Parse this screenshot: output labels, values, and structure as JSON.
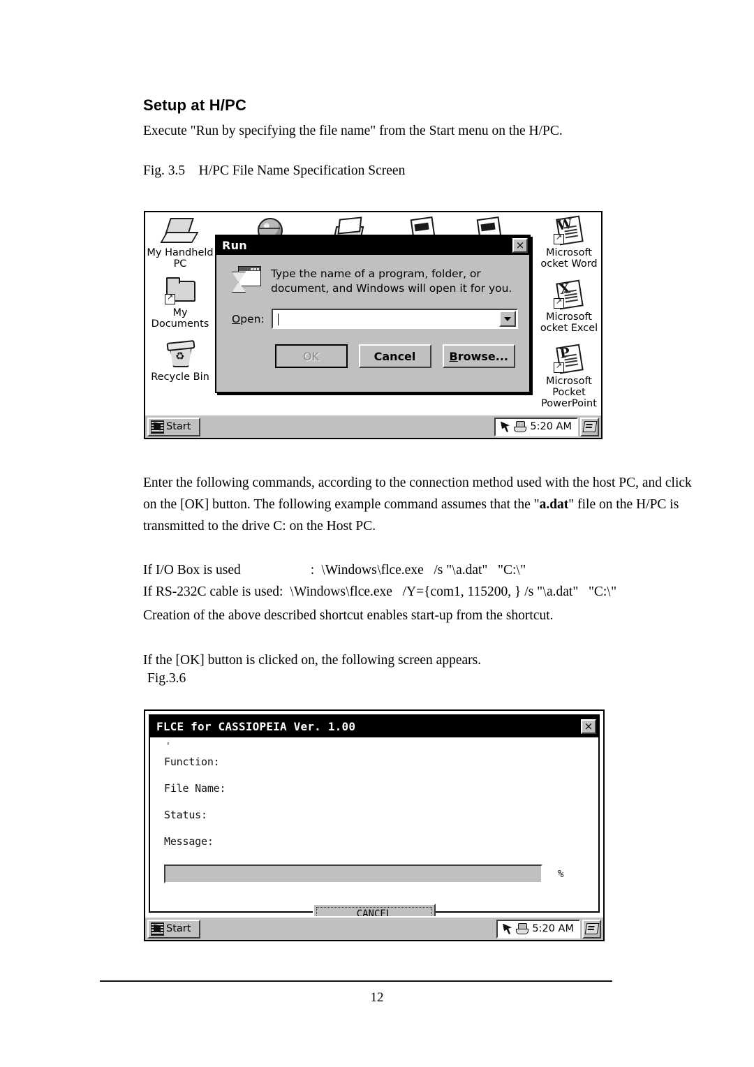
{
  "document": {
    "heading": "Setup at H/PC",
    "intro": "Execute \"Run by specifying the file name\" from the Start menu on the H/PC.",
    "figure_caption_1": "Fig. 3.5    H/PC File Name Specification Screen",
    "body_line_1": "Enter the following commands, according to the connection method used with the host PC, and click",
    "body_line_2a": "on the [OK] button. The following example command assumes that the \"",
    "body_line_2_bold": "a.dat",
    "body_line_2b": "\" file on the H/PC is",
    "body_line_3": "transmitted to the drive C: on the Host PC.",
    "command_iobox_label": "If I/O Box is used",
    "command_iobox_colon": ":",
    "command_rs232c_label": "If RS-232C cable is used:",
    "command_path_prefix": "Windows",
    "command_exe": "flce.exe",
    "command_iobox_switches": "/s \"",
    "command_rs232c_switches": "/Y={com1, 115200, } /s \"",
    "command_datfile": "a.dat\"",
    "command_drive": "\"C:",
    "command_trailing_quote": "\"",
    "shortcut_note": "Creation of the above described shortcut enables start-up from the shortcut.",
    "ok_note": "If the [OK] button is clicked on, the following screen appears.",
    "figure_caption_2": "Fig.3.6",
    "page_number": "12"
  },
  "figure_hpc": {
    "desktop_icons_left": [
      {
        "label_line1": "My Handheld",
        "label_line2": "PC",
        "icon": "laptop-icon"
      },
      {
        "label_line1": "My",
        "label_line2": "Documents",
        "icon": "folder-shortcut-icon"
      },
      {
        "label_line1": "Recycle Bin",
        "label_line2": "",
        "icon": "recycle-bin-icon"
      }
    ],
    "desktop_icons_top": [
      {
        "icon": "globe-icon"
      },
      {
        "icon": "inbox-icon"
      },
      {
        "icon": "document-icon"
      },
      {
        "icon": "fax-icon"
      }
    ],
    "desktop_icons_right": [
      {
        "label_line1": "Microsoft",
        "label_line2": "ocket Word",
        "label_line3": "",
        "icon": "pocket-word-icon",
        "letter": "W"
      },
      {
        "label_line1": "Microsoft",
        "label_line2": "ocket Excel",
        "label_line3": "",
        "icon": "pocket-excel-icon",
        "letter": "X"
      },
      {
        "label_line1": "Microsoft",
        "label_line2": "Pocket",
        "label_line3": "PowerPoint",
        "icon": "pocket-powerpoint-icon",
        "letter": "P"
      }
    ],
    "run_dialog": {
      "title": "Run",
      "close_label": "×",
      "description_line1": "Type the name of a program, folder, or",
      "description_line2": "document, and Windows will open it for you.",
      "open_label_accel": "O",
      "open_label_rest": "pen:",
      "open_value": "",
      "ok_label": "OK",
      "cancel_label": "Cancel",
      "browse_accel": "B",
      "browse_rest": "rowse..."
    },
    "taskbar": {
      "start_label": "Start",
      "time": "5:20 AM"
    }
  },
  "figure_flce": {
    "window_title": "FLCE for CASSIOPEIA  Ver. 1.00",
    "close_label": "×",
    "tick_mark": "'",
    "fields": [
      {
        "label": "Function:",
        "value": ""
      },
      {
        "label": "File Name:",
        "value": ""
      },
      {
        "label": "Status:",
        "value": ""
      },
      {
        "label": "Message:",
        "value": ""
      }
    ],
    "progress_percent_label": "%",
    "progress_value": 0,
    "cancel_label": "CANCEL",
    "taskbar": {
      "start_label": "Start",
      "time": "5:20 AM"
    }
  }
}
